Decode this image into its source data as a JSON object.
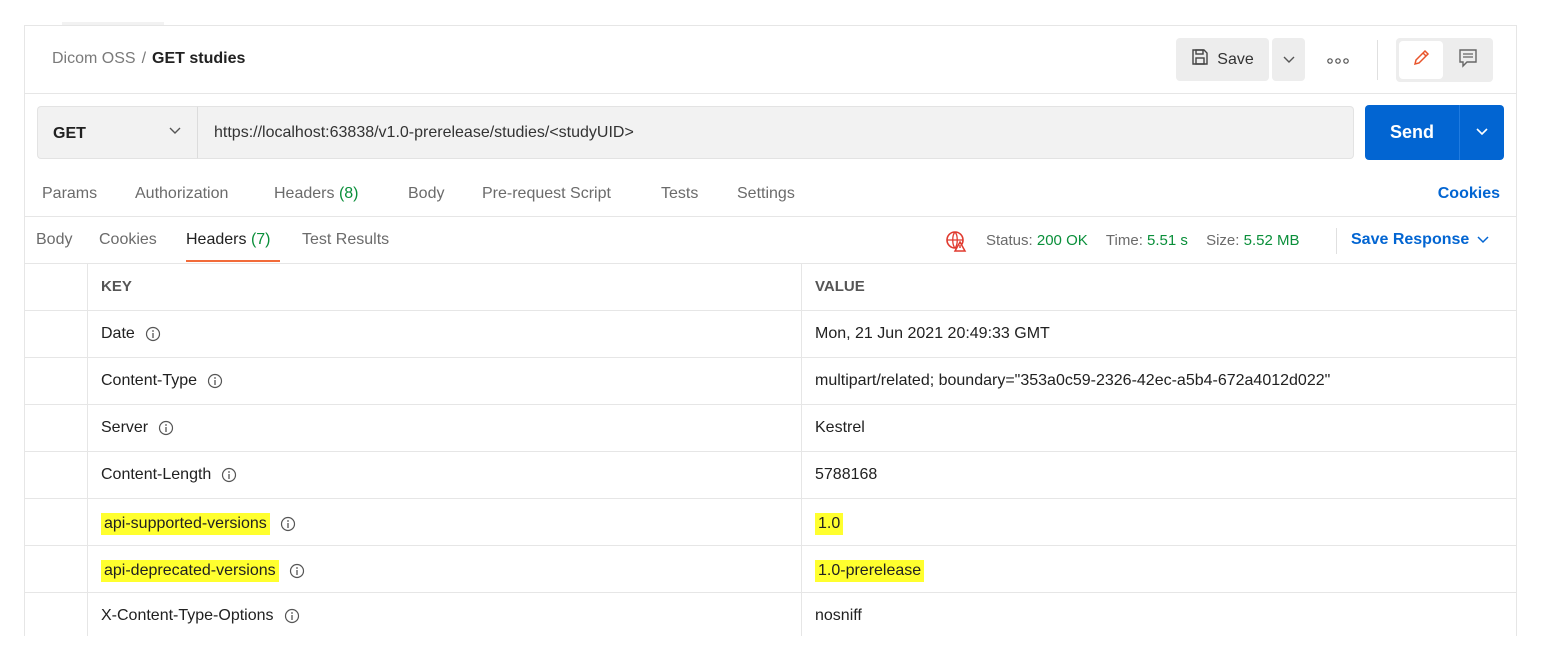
{
  "breadcrumb": {
    "parent": "Dicom OSS",
    "separator": "/",
    "current": "GET studies"
  },
  "header": {
    "save_label": "Save"
  },
  "request": {
    "method": "GET",
    "url": "https://localhost:63838/v1.0-prerelease/studies/<studyUID>",
    "send_label": "Send"
  },
  "request_tabs": {
    "params": "Params",
    "authorization": "Authorization",
    "headers": "Headers",
    "headers_count": "(8)",
    "body": "Body",
    "pre_request": "Pre-request Script",
    "tests": "Tests",
    "settings": "Settings",
    "cookies_link": "Cookies"
  },
  "response_tabs": {
    "body": "Body",
    "cookies": "Cookies",
    "headers": "Headers",
    "headers_count": "(7)",
    "test_results": "Test Results"
  },
  "status": {
    "status_label": "Status:",
    "status_value": "200 OK",
    "time_label": "Time:",
    "time_value": "5.51 s",
    "size_label": "Size:",
    "size_value": "5.52 MB",
    "save_response": "Save Response"
  },
  "table": {
    "key_header": "KEY",
    "value_header": "VALUE",
    "rows": [
      {
        "key": "Date",
        "value": "Mon, 21 Jun 2021 20:49:33 GMT"
      },
      {
        "key": "Content-Type",
        "value": "multipart/related; boundary=\"353a0c59-2326-42ec-a5b4-672a4012d022\""
      },
      {
        "key": "Server",
        "value": "Kestrel"
      },
      {
        "key": "Content-Length",
        "value": "5788168"
      },
      {
        "key": "api-supported-versions",
        "value": "1.0",
        "highlighted": true
      },
      {
        "key": "api-deprecated-versions",
        "value": "1.0-prerelease",
        "highlighted": true
      },
      {
        "key": "X-Content-Type-Options",
        "value": "nosniff"
      }
    ]
  },
  "colors": {
    "accent_blue": "#0265d2",
    "success_green": "#0a8f3a",
    "active_tab_orange": "#f26b3a",
    "highlight_yellow": "#ffff2e",
    "error_red": "#e03a2f"
  },
  "icons": [
    "floppy-disk-icon",
    "chevron-down-icon",
    "more-dots-icon",
    "pencil-icon",
    "comment-icon",
    "network-error-icon",
    "info-icon"
  ]
}
